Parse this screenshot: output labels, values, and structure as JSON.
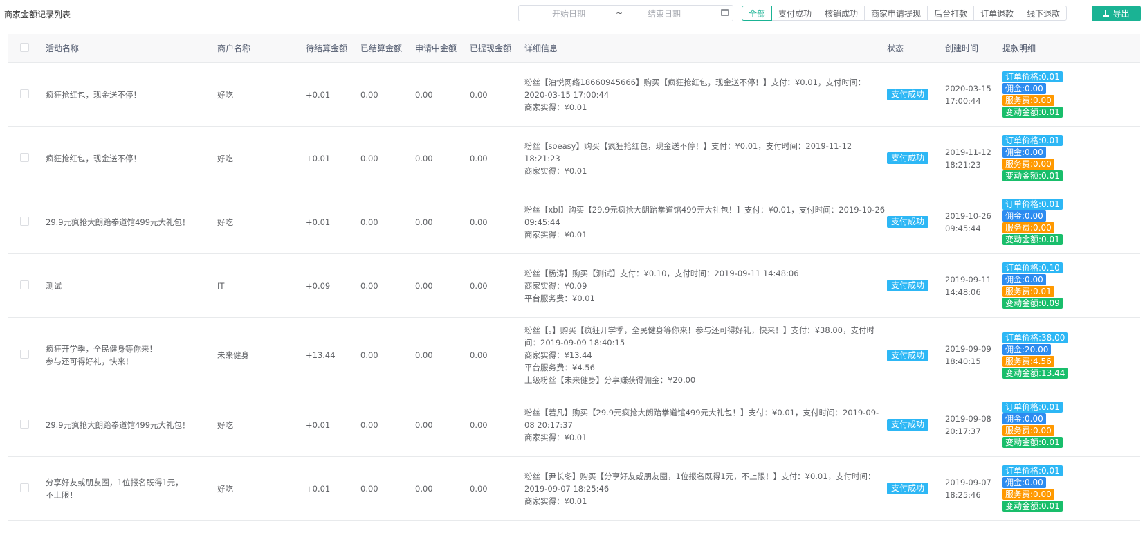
{
  "page_title": "商家金额记录列表",
  "date_range": {
    "start_placeholder": "开始日期",
    "separator": "~",
    "end_placeholder": "结束日期"
  },
  "filters": [
    "全部",
    "支付成功",
    "核销成功",
    "商家申请提现",
    "后台打款",
    "订单退款",
    "线下退款"
  ],
  "active_filter": "全部",
  "export_label": "导出",
  "colors": {
    "accent": "#1ab394",
    "status_blue": "#2db7f5",
    "comm_blue": "#2d8cf0",
    "fee_orange": "#ff9900",
    "change_green": "#19be6b"
  },
  "table": {
    "columns": [
      "活动名称",
      "商户名称",
      "待结算金额",
      "已结算金额",
      "申请中金额",
      "已提现金额",
      "详细信息",
      "状态",
      "创建时间",
      "提款明细"
    ],
    "rows": [
      {
        "name": [
          "疯狂抢红包，现金送不停！"
        ],
        "merchant": "好吃",
        "pending": "+0.01",
        "settled": "0.00",
        "applying": "0.00",
        "withdrawn": "0.00",
        "detail": [
          "粉丝【泊悦网络18660945666】购买【疯狂抢红包，现金送不停！】支付：¥0.01，支付时间：2020-03-15 17:00:44",
          "商家实得：¥0.01"
        ],
        "status": "支付成功",
        "created": [
          "2020-03-15",
          "17:00:44"
        ],
        "tags": [
          "订单价格:0.01",
          "佣金:0.00",
          "服务费:0.00",
          "变动金额:0.01"
        ]
      },
      {
        "name": [
          "疯狂抢红包，现金送不停！"
        ],
        "merchant": "好吃",
        "pending": "+0.01",
        "settled": "0.00",
        "applying": "0.00",
        "withdrawn": "0.00",
        "detail": [
          "粉丝【soeasy】购买【疯狂抢红包，现金送不停！】支付：¥0.01，支付时间：2019-11-12 18:21:23",
          "商家实得：¥0.01"
        ],
        "status": "支付成功",
        "created": [
          "2019-11-12",
          "18:21:23"
        ],
        "tags": [
          "订单价格:0.01",
          "佣金:0.00",
          "服务费:0.00",
          "变动金额:0.01"
        ]
      },
      {
        "name": [
          "29.9元疯抢大朗跆拳道馆499元大礼包！"
        ],
        "merchant": "好吃",
        "pending": "+0.01",
        "settled": "0.00",
        "applying": "0.00",
        "withdrawn": "0.00",
        "detail": [
          "粉丝【xbl】购买【29.9元疯抢大朗跆拳道馆499元大礼包！】支付：¥0.01，支付时间：2019-10-26 09:45:44",
          "商家实得：¥0.01"
        ],
        "status": "支付成功",
        "created": [
          "2019-10-26",
          "09:45:44"
        ],
        "tags": [
          "订单价格:0.01",
          "佣金:0.00",
          "服务费:0.00",
          "变动金额:0.01"
        ]
      },
      {
        "name": [
          "测试"
        ],
        "merchant": "IT",
        "pending": "+0.09",
        "settled": "0.00",
        "applying": "0.00",
        "withdrawn": "0.00",
        "detail": [
          "粉丝【杨涛】购买【测试】支付：¥0.10，支付时间：2019-09-11 14:48:06",
          "商家实得：¥0.09",
          "平台服务费：¥0.01"
        ],
        "status": "支付成功",
        "created": [
          "2019-09-11",
          "14:48:06"
        ],
        "tags": [
          "订单价格:0.10",
          "佣金:0.00",
          "服务费:0.01",
          "变动金额:0.09"
        ]
      },
      {
        "name": [
          "疯狂开学季，全民健身等你来！",
          "参与还可得好礼，快来！"
        ],
        "merchant": "未来健身",
        "pending": "+13.44",
        "settled": "0.00",
        "applying": "0.00",
        "withdrawn": "0.00",
        "detail": [
          "粉丝【。】购买【疯狂开学季，全民健身等你来！参与还可得好礼，快来！】支付：¥38.00，支付时间：2019-09-09 18:40:15",
          "商家实得：¥13.44",
          "平台服务费：¥4.56",
          "上级粉丝【未来健身】分享赚获得佣金：¥20.00"
        ],
        "status": "支付成功",
        "created": [
          "2019-09-09",
          "18:40:15"
        ],
        "tags": [
          "订单价格:38.00",
          "佣金:20.00",
          "服务费:4.56",
          "变动金额:13.44"
        ]
      },
      {
        "name": [
          "29.9元疯抢大朗跆拳道馆499元大礼包！"
        ],
        "merchant": "好吃",
        "pending": "+0.01",
        "settled": "0.00",
        "applying": "0.00",
        "withdrawn": "0.00",
        "detail": [
          "粉丝【若凡】购买【29.9元疯抢大朗跆拳道馆499元大礼包！】支付：¥0.01，支付时间：2019-09-08 20:17:37",
          "商家实得：¥0.01"
        ],
        "status": "支付成功",
        "created": [
          "2019-09-08",
          "20:17:37"
        ],
        "tags": [
          "订单价格:0.01",
          "佣金:0.00",
          "服务费:0.00",
          "变动金额:0.01"
        ]
      },
      {
        "name": [
          "分享好友或朋友圈，1位报名既得1元，",
          "不上限！"
        ],
        "merchant": "好吃",
        "pending": "+0.01",
        "settled": "0.00",
        "applying": "0.00",
        "withdrawn": "0.00",
        "detail": [
          "粉丝【尹长冬】购买【分享好友或朋友圈，1位报名既得1元，不上限！】支付：¥0.01，支付时间：2019-09-07 18:25:46",
          "商家实得：¥0.01"
        ],
        "status": "支付成功",
        "created": [
          "2019-09-07",
          "18:25:46"
        ],
        "tags": [
          "订单价格:0.01",
          "佣金:0.00",
          "服务费:0.00",
          "变动金额:0.01"
        ]
      }
    ]
  }
}
